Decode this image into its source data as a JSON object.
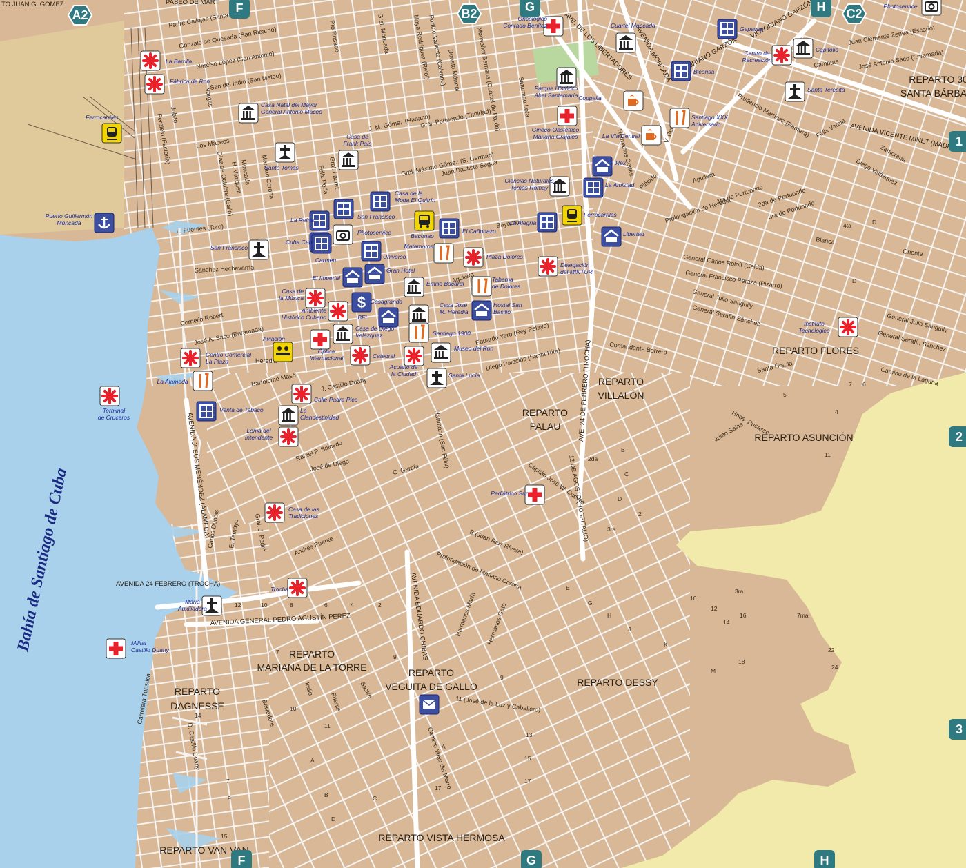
{
  "map": {
    "bay_label": "Bahía de Santiago de Cuba",
    "top_left_text": "TO JUAN G. GÓMEZ",
    "top_street_fragment": "PASEO DE MART",
    "grid_cells": {
      "top": [
        {
          "id": "A2"
        },
        {
          "id": "F"
        },
        {
          "id": "B2"
        },
        {
          "id": "G"
        },
        {
          "id": "H"
        },
        {
          "id": "C2"
        }
      ],
      "bottom": [
        {
          "id": "F"
        },
        {
          "id": "G"
        },
        {
          "id": "H"
        }
      ],
      "right": [
        {
          "id": "1"
        },
        {
          "id": "2"
        },
        {
          "id": "3"
        }
      ]
    },
    "districts": [
      {
        "lines": [
          "REPARTO 30",
          "SANTA BÁRBAR"
        ]
      },
      {
        "lines": [
          "REPARTO FLORES"
        ]
      },
      {
        "lines": [
          "REPARTO",
          "VILLALÓN"
        ]
      },
      {
        "lines": [
          "REPARTO",
          "PALAU"
        ]
      },
      {
        "lines": [
          "REPARTO ASUNCIÓN"
        ]
      },
      {
        "lines": [
          "REPARTO",
          "MARIANA DE LA TORRE"
        ]
      },
      {
        "lines": [
          "REPARTO",
          "VEGUITA DE GALLO"
        ]
      },
      {
        "lines": [
          "REPARTO DESSY"
        ]
      },
      {
        "lines": [
          "REPARTO",
          "DAGNESSE"
        ]
      },
      {
        "lines": [
          "REPARTO VISTA HERMOSA"
        ]
      },
      {
        "lines": [
          "REPARTO VAN VAN"
        ]
      }
    ],
    "streets": [
      "Padre Callejas (Santa Lucía)",
      "Gonzalo de Quesada (San Ricardo)",
      "Narciso López (San Antonio)",
      "Sao del Indio (San Mateo)",
      "Pío Rosado",
      "Gral. Moncada",
      "Maya Rodríguez (Reloj)",
      "Porfirio Valiente (Calvario)",
      "Donato Mármol",
      "Monseñor Barnada (Cuartel de Pardo)",
      "Saturnino Lora",
      "AVE. DE LOS LIBERTADORES",
      "AVENIDA MONCADA",
      "VICTORIANO GARZÓN",
      "J. M. Gómez (Habana)",
      "Gral. Portuondo (Trinidad)",
      "Gral. Máximo Gómez (S. Germán)",
      "Juan Bautista Sagua",
      "Los Maceos",
      "Díaz de Octubre (Gallo)",
      "Mariano Corona",
      "Félix Peña",
      "Gral. Lacret",
      "Bayamo",
      "Aguilera",
      "L. Fuentes (Toro)",
      "Sánchez Hechevarría",
      "Cornelio Robert",
      "José A. Saco (Enramada)",
      "Heredia",
      "Bartolomé Masó",
      "J. Castillo Duany",
      "Rafael P. Salcedo",
      "José de Diego",
      "Eduardo Yero (Rey Pelayo)",
      "Diego Palacios (Santa Rita)",
      "Hartmann (San Félix)",
      "C. García",
      "AVE. 24 DE FEBRERO (TROCHA)",
      "AVENIDA 24 FEBRERO (TROCHA)",
      "AVENIDA GENERAL PEDRO AGUSTÍN PÉREZ",
      "AVENIDA JESÚS MENÉNDEZ (ALAMEDA)",
      "AVENIDA EDUARDO CHIBÁS",
      "Capitán José W. Cuevas",
      "12 DE AGOSTO (HOSPITALIO)",
      "Prolongación de Mariano Corona",
      "B (Juan Rius Rivera)",
      "Andrés Puente",
      "Carlos Dubois",
      "Comandante Borrero",
      "General Carlos Roloff (Celda)",
      "General Francisco Peraza (Pizarro)",
      "General Julio Sanguily",
      "General Serafín Sánchez",
      "Camino de la Laguna",
      "Santa Úrsula",
      "Hnos. Ducasse",
      "Justo Salas",
      "AVENIDA VICENTE MINET (MADRE VIEJA)",
      "Prudencio Martínez (Pedrera)",
      "Félix Varela",
      "Diego Velázquez",
      "Zamorana",
      "Juan Clemente Zenea (Escario)",
      "José Antonio Saco (Enramada)",
      "Cambute",
      "Carretera Turística",
      "D. Castillo Duany",
      "Camino Viejo del Morro",
      "11 (José de la Luz y Caballero)",
      "Hermanos Marín",
      "Hermanos Gato",
      "Belvedere",
      "Indio",
      "Fuente",
      "Sastre",
      "Prolongación de Heredia",
      "Oriente",
      "Blanca",
      "1ra de Portuondo",
      "2da de Portuondo",
      "3ra de Portuondo",
      "Plácido",
      "Hermanos Cortés",
      "V. Betancourt",
      "Vargas",
      "Jobito",
      "Peralejo (Factoría)",
      "Moncada",
      "H. Vázquez",
      "Trocha",
      "Gral. J. Padró",
      "E. Tamayo"
    ],
    "pois": [
      {
        "label": "La Barrilla",
        "icon": "asterisk-icon"
      },
      {
        "label": "Fábrica de Ron",
        "icon": "asterisk-icon"
      },
      {
        "label": "Casa Natal del Mayor General Antonio Maceo",
        "icon": "museum-icon"
      },
      {
        "label": "Ferrocarriles",
        "icon": "train-icon"
      },
      {
        "label": "Puerto Guillermón Moncada",
        "icon": "anchor-icon"
      },
      {
        "label": "Santo Tomás",
        "icon": "church-icon"
      },
      {
        "label": "Casa de Frank País",
        "icon": "museum-icon"
      },
      {
        "label": "San Francisco",
        "icon": "church-icon"
      },
      {
        "label": "La Reina",
        "icon": "shop-icon"
      },
      {
        "label": "Cuba Centro",
        "icon": "shop-icon"
      },
      {
        "label": "San Francisco",
        "icon": "shop-icon"
      },
      {
        "label": "Photoservice",
        "icon": "camera-icon"
      },
      {
        "label": "Carmen",
        "icon": "shop-icon"
      },
      {
        "label": "Universo",
        "icon": "shop-icon"
      },
      {
        "label": "Casa de la Moda El Quitrín",
        "icon": "shop-icon"
      },
      {
        "label": "Baconao",
        "icon": "bus-icon"
      },
      {
        "label": "El Cañonazo",
        "icon": "shop-icon"
      },
      {
        "label": "Matamoros",
        "icon": "restaurant-icon"
      },
      {
        "label": "Plaza Dolores",
        "icon": "asterisk-icon"
      },
      {
        "label": "El Imperial",
        "icon": "hotel-icon"
      },
      {
        "label": "Gran Hotel",
        "icon": "hotel-icon"
      },
      {
        "label": "Emilio Bacardí",
        "icon": "museum-icon"
      },
      {
        "label": "Taberna de Dolores",
        "icon": "restaurant-icon"
      },
      {
        "label": "Hostal San Basilio",
        "icon": "hotel-icon"
      },
      {
        "label": "Casa de la Música",
        "icon": "asterisk-icon"
      },
      {
        "label": "Ambiente Histórico Cubano",
        "icon": "asterisk-icon"
      },
      {
        "label": "BFI",
        "icon": "bank-icon"
      },
      {
        "label": "Casagranda",
        "icon": "hotel-icon"
      },
      {
        "label": "Casa José M. Heredia",
        "icon": "museum-icon"
      },
      {
        "label": "Casa de Diego Velázquez",
        "icon": "museum-icon"
      },
      {
        "label": "Santiago 1900",
        "icon": "restaurant-icon"
      },
      {
        "label": "Aviación",
        "icon": "airline-icon"
      },
      {
        "label": "Óptica Internacional",
        "icon": "hospital-icon"
      },
      {
        "label": "Catedral",
        "icon": "asterisk-icon"
      },
      {
        "label": "Acuario de la Ciudad",
        "icon": "asterisk-icon"
      },
      {
        "label": "Museo del Ron",
        "icon": "museum-icon"
      },
      {
        "label": "Santa Lucía",
        "icon": "church-icon"
      },
      {
        "label": "Centro Comercial La Plaza",
        "icon": "asterisk-icon"
      },
      {
        "label": "La Alameda",
        "icon": "restaurant-icon"
      },
      {
        "label": "Terminal de Cruceros",
        "icon": "asterisk-icon"
      },
      {
        "label": "Venta de Tabaco",
        "icon": "shop-icon"
      },
      {
        "label": "Calle Padre Pico",
        "icon": "asterisk-icon"
      },
      {
        "label": "La Clandestinidad",
        "icon": "museum-icon"
      },
      {
        "label": "Loma del Intendente",
        "icon": "asterisk-icon"
      },
      {
        "label": "Casa de las Tradiciones",
        "icon": "asterisk-icon"
      },
      {
        "label": "Trocha",
        "icon": "asterisk-icon"
      },
      {
        "label": "María Auxiliadora",
        "icon": "church-icon"
      },
      {
        "label": "Militar Castillo Duany",
        "icon": "hospital-icon"
      },
      {
        "label": "Oncológico Conrado Benítez",
        "icon": "hospital-icon"
      },
      {
        "label": "Cuartel Moncada",
        "icon": "museum-icon"
      },
      {
        "label": "Parque Histórico Abel Santamaría",
        "icon": "museum-icon"
      },
      {
        "label": "Gineco-Obstétrico Mariana Grajales",
        "icon": "hospital-icon"
      },
      {
        "label": "Coppelia",
        "icon": "cafe-icon"
      },
      {
        "label": "La Vía Central",
        "icon": "cafe-icon"
      },
      {
        "label": "Santiago XXX Aniversario",
        "icon": "restaurant-icon"
      },
      {
        "label": "Biconsa",
        "icon": "shop-icon"
      },
      {
        "label": "Gepavep",
        "icon": "shop-icon"
      },
      {
        "label": "Centro de Recreación",
        "icon": "asterisk-icon"
      },
      {
        "label": "Capitolio",
        "icon": "museum-icon"
      },
      {
        "label": "Santa Teresita",
        "icon": "church-icon"
      },
      {
        "label": "Rex",
        "icon": "hotel-icon"
      },
      {
        "label": "La Amistad",
        "icon": "shop-icon"
      },
      {
        "label": "Ciencias Naturales Tomás Romay",
        "icon": "museum-icon"
      },
      {
        "label": "Ferrocarriles",
        "icon": "train-icon"
      },
      {
        "label": "La Alegría",
        "icon": "shop-icon"
      },
      {
        "label": "Libertad",
        "icon": "hotel-icon"
      },
      {
        "label": "Delegación del MINTUR",
        "icon": "asterisk-icon"
      },
      {
        "label": "Instituto Tecnológico",
        "icon": "asterisk-icon"
      },
      {
        "label": "Pediátrico Sur",
        "icon": "hospital-icon"
      },
      {
        "label": "Photoservice",
        "icon": "camera-icon"
      }
    ],
    "postal": {
      "icon": "mail-icon"
    },
    "colors": {
      "land": "#d8b896",
      "street": "#f6f4f2",
      "water": "#a9d1ec",
      "undeveloped": "#f2eaaa",
      "badge": "#2e7a80",
      "asterisk": "#e8212a",
      "hospital": "#e8212a",
      "blue_icon": "#3c4ea0",
      "yellow_icon": "#f2d500",
      "label_blue": "#1a2a9a"
    }
  }
}
